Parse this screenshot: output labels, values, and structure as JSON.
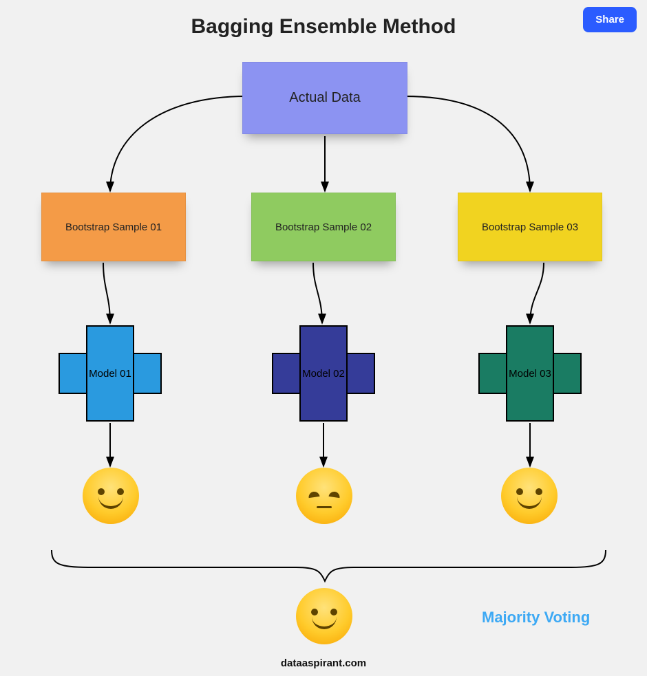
{
  "title": "Bagging Ensemble Method",
  "share_label": "Share",
  "root": {
    "label": "Actual Data"
  },
  "samples": [
    {
      "label": "Bootstrap Sample 01",
      "color": "#f49b47"
    },
    {
      "label": "Bootstrap Sample 02",
      "color": "#8fcb60"
    },
    {
      "label": "Bootstrap Sample 03",
      "color": "#f1d320"
    }
  ],
  "models": [
    {
      "label": "Model 01",
      "color": "#2a9adf"
    },
    {
      "label": "Model 02",
      "color": "#353c99"
    },
    {
      "label": "Model 03",
      "color": "#1a7c63"
    }
  ],
  "outputs": [
    {
      "mood": "happy"
    },
    {
      "mood": "sad"
    },
    {
      "mood": "happy"
    }
  ],
  "aggregate": {
    "label": "Majority Voting",
    "mood": "happy"
  },
  "credit": "dataaspirant.com"
}
